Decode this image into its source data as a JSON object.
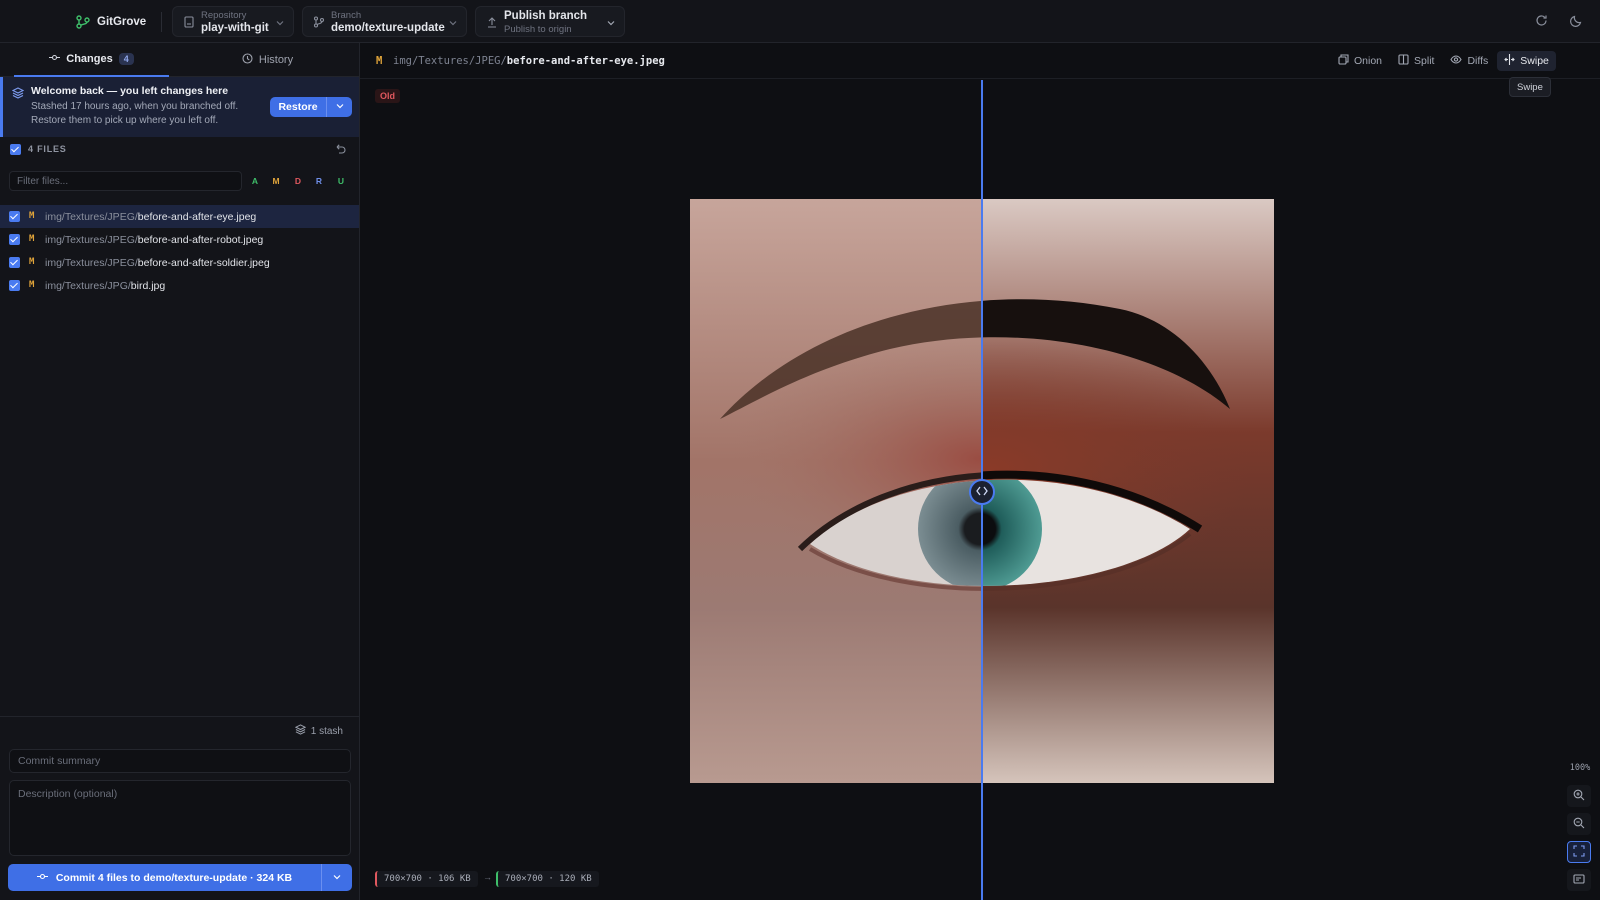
{
  "app": {
    "name": "GitGrove"
  },
  "repository": {
    "label": "Repository",
    "value": "play-with-git"
  },
  "branch": {
    "label": "Branch",
    "value": "demo/texture-update"
  },
  "publish": {
    "title": "Publish branch",
    "subtitle": "Publish to origin"
  },
  "tabs": {
    "changes": "Changes",
    "changes_count": "4",
    "history": "History"
  },
  "banner": {
    "title": "Welcome back — you left changes here",
    "line1": "Stashed 17 hours ago, when you branched off.",
    "line2": "Restore them to pick up where you left off.",
    "restore_label": "Restore"
  },
  "files": {
    "header": "4 FILES",
    "filter_placeholder": "Filter files...",
    "status_filters": [
      "A",
      "M",
      "D",
      "R",
      "U"
    ],
    "status_filter_colors": [
      "#3fbf6a",
      "#e0a43a",
      "#e0585e",
      "#6f8fe8",
      "#3fbf6a"
    ],
    "items": [
      {
        "status": "M",
        "dir": "img/Textures/JPEG/",
        "name": "before-and-after-eye.jpeg",
        "checked": true,
        "selected": true
      },
      {
        "status": "M",
        "dir": "img/Textures/JPEG/",
        "name": "before-and-after-robot.jpeg",
        "checked": true,
        "selected": false
      },
      {
        "status": "M",
        "dir": "img/Textures/JPEG/",
        "name": "before-and-after-soldier.jpeg",
        "checked": true,
        "selected": false
      },
      {
        "status": "M",
        "dir": "img/Textures/JPG/",
        "name": "bird.jpg",
        "checked": true,
        "selected": false
      }
    ]
  },
  "stash": {
    "label": "1 stash"
  },
  "commit": {
    "summary_placeholder": "Commit summary",
    "description_placeholder": "Description (optional)",
    "button_label": "Commit 4 files to demo/texture-update · 324 KB"
  },
  "viewer": {
    "status": "M",
    "dir": "img/Textures/JPEG/",
    "name": "before-and-after-eye.jpeg",
    "modes": [
      "Onion",
      "Split",
      "Diffs",
      "Swipe"
    ],
    "active_mode": "Swipe",
    "tooltip": "Swipe",
    "old_badge": "Old",
    "swipe_position": 0.5,
    "old_info": "700×700 · 106 KB",
    "arrow": "→",
    "new_info": "700×700 · 120 KB",
    "zoom": "100%"
  },
  "colors": {
    "accent": "#4a7bf0",
    "modified": "#e0a43a",
    "deleted": "#e0585e",
    "added": "#3fbf6a"
  }
}
